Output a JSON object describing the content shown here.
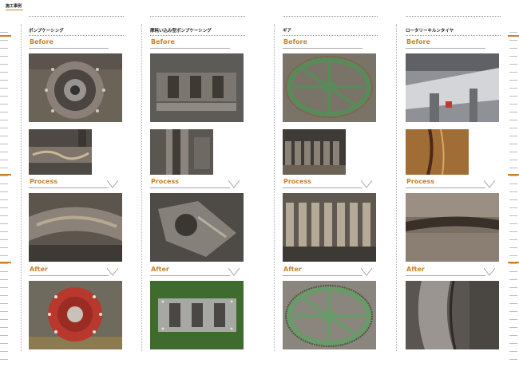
{
  "header": {
    "label": "施工事例"
  },
  "sections": {
    "before": "Before",
    "process": "Process",
    "after": "After"
  },
  "columns": [
    {
      "title": "ポンプケーシング"
    },
    {
      "title": "摩耗い込み型ポンプケーシング"
    },
    {
      "title": "ギア"
    },
    {
      "title": "ロータリーキルンタイヤ"
    }
  ],
  "photos": {
    "c1_before": "pump-casing-before",
    "c1_detail": "pump-casing-detail",
    "c1_process": "pump-casing-welding",
    "c1_after": "pump-casing-painted-red",
    "c2_before": "casing-before",
    "c2_detail": "casing-detail",
    "c2_process": "casing-process",
    "c2_after": "casing-after",
    "c3_before": "gear-before",
    "c3_detail": "gear-teeth-worn",
    "c3_process": "gear-teeth-rebuild",
    "c3_after": "gear-after",
    "c4_before": "kiln-before",
    "c4_detail": "kiln-tire-crack",
    "c4_process": "kiln-tire-process",
    "c4_after": "kiln-tire-after"
  }
}
